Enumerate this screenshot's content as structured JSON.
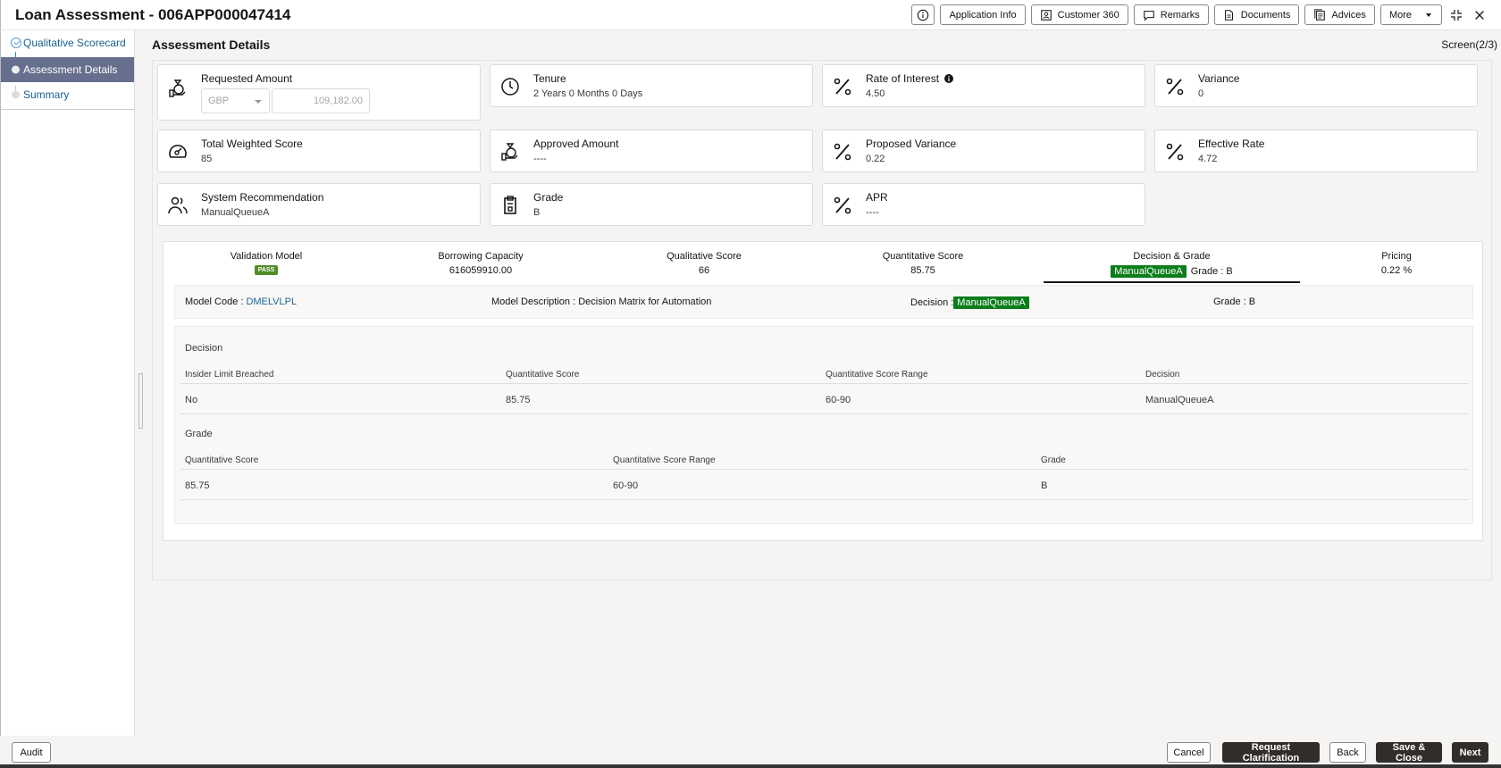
{
  "header": {
    "title": "Loan Assessment - 006APP000047414",
    "buttons": {
      "info": "info",
      "application_info": "Application Info",
      "customer_360": "Customer 360",
      "remarks": "Remarks",
      "documents": "Documents",
      "advices": "Advices",
      "more": "More"
    }
  },
  "sidebar": {
    "steps": [
      {
        "label": "Qualitative Scorecard",
        "state": "completed"
      },
      {
        "label": "Assessment Details",
        "state": "active"
      },
      {
        "label": "Summary",
        "state": "pending"
      }
    ]
  },
  "main": {
    "section_title": "Assessment Details",
    "screen_count": "Screen(2/3)",
    "cards": {
      "requested_amount": {
        "label": "Requested Amount",
        "currency": "GBP",
        "amount": "109,182.00"
      },
      "tenure": {
        "label": "Tenure",
        "value": "2 Years 0 Months 0 Days"
      },
      "rate_of_interest": {
        "label": "Rate of Interest",
        "value": "4.50"
      },
      "variance": {
        "label": "Variance",
        "value": "0"
      },
      "total_weighted_score": {
        "label": "Total Weighted Score",
        "value": "85"
      },
      "approved_amount": {
        "label": "Approved Amount",
        "value": "----"
      },
      "proposed_variance": {
        "label": "Proposed Variance",
        "value": "0.22"
      },
      "effective_rate": {
        "label": "Effective Rate",
        "value": "4.72"
      },
      "system_recommendation": {
        "label": "System Recommendation",
        "value": "ManualQueueA"
      },
      "grade": {
        "label": "Grade",
        "value": "B"
      },
      "apr": {
        "label": "APR",
        "value": "----"
      }
    },
    "score_tabs": {
      "validation_model": {
        "label": "Validation Model",
        "badge": "PASS"
      },
      "borrowing_capacity": {
        "label": "Borrowing Capacity",
        "value": "616059910.00"
      },
      "qualitative_score": {
        "label": "Qualitative Score",
        "value": "66"
      },
      "quantitative_score": {
        "label": "Quantitative Score",
        "value": "85.75"
      },
      "decision_grade": {
        "label": "Decision & Grade",
        "decision": "ManualQueueA",
        "grade": "Grade : B"
      },
      "pricing": {
        "label": "Pricing",
        "value": "0.22 %"
      }
    },
    "model": {
      "code_label": "Model Code : ",
      "code": "DMELVLPL",
      "description": "Model Description : Decision Matrix for Automation",
      "decision_label": "Decision : ",
      "decision": "ManualQueueA",
      "grade": "Grade : B"
    },
    "decision_table": {
      "title": "Decision",
      "headers": [
        "Insider Limit Breached",
        "Quantitative Score",
        "Quantitative Score Range",
        "Decision"
      ],
      "rows": [
        [
          "No",
          "85.75",
          "60-90",
          "ManualQueueA"
        ]
      ]
    },
    "grade_table": {
      "title": "Grade",
      "headers": [
        "Quantitative Score",
        "Quantitative Score Range",
        "Grade"
      ],
      "rows": [
        [
          "85.75",
          "60-90",
          "B"
        ]
      ]
    }
  },
  "footer": {
    "audit": "Audit",
    "cancel": "Cancel",
    "request_clarification": "Request Clarification",
    "back": "Back",
    "save_close": "Save & Close",
    "next": "Next"
  }
}
